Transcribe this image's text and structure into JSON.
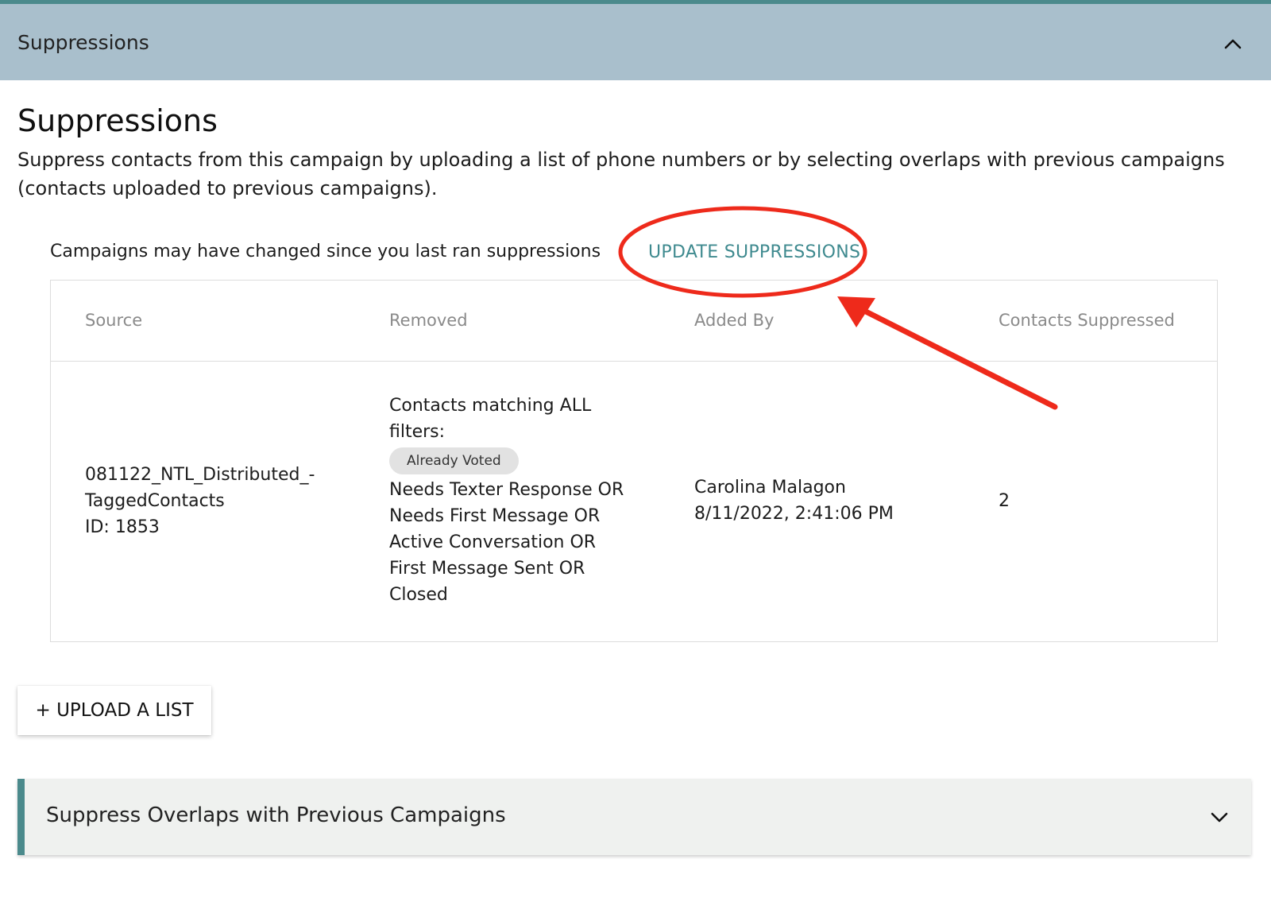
{
  "accordion": {
    "title": "Suppressions",
    "expanded_icon": "chevron-up-icon"
  },
  "section": {
    "title": "Suppressions",
    "description": "Suppress contacts from this campaign by uploading a list of phone numbers or by selecting overlaps with previous campaigns (contacts uploaded to previous campaigns)."
  },
  "notice": {
    "text": "Campaigns may have changed since you last ran suppressions",
    "update_link": "UPDATE SUPPRESSIONS"
  },
  "table": {
    "headers": [
      "Source",
      "Removed",
      "Added By",
      "Contacts Suppressed"
    ],
    "rows": [
      {
        "source_line1": "081122_NTL_Distributed_-",
        "source_line2": "TaggedContacts",
        "source_id": "ID: 1853",
        "removed_intro_1": "Contacts matching ALL",
        "removed_intro_2": "filters:",
        "removed_tag": "Already Voted",
        "removed_lines": [
          "Needs Texter Response OR",
          "Needs First Message OR",
          "Active Conversation OR",
          "First Message Sent OR",
          "Closed"
        ],
        "added_by_name": "Carolina Malagon",
        "added_by_date": "8/11/2022, 2:41:06 PM",
        "contacts_suppressed": "2"
      }
    ]
  },
  "upload_button": {
    "label": "+ UPLOAD A LIST"
  },
  "overlap_panel": {
    "title": "Suppress Overlaps with Previous Campaigns",
    "collapsed_icon": "chevron-down-icon"
  },
  "colors": {
    "accent": "#4b8a8c",
    "header_bg": "#a9bfcc",
    "link": "#3f8a8f",
    "annotation": "#ee2a1b"
  }
}
